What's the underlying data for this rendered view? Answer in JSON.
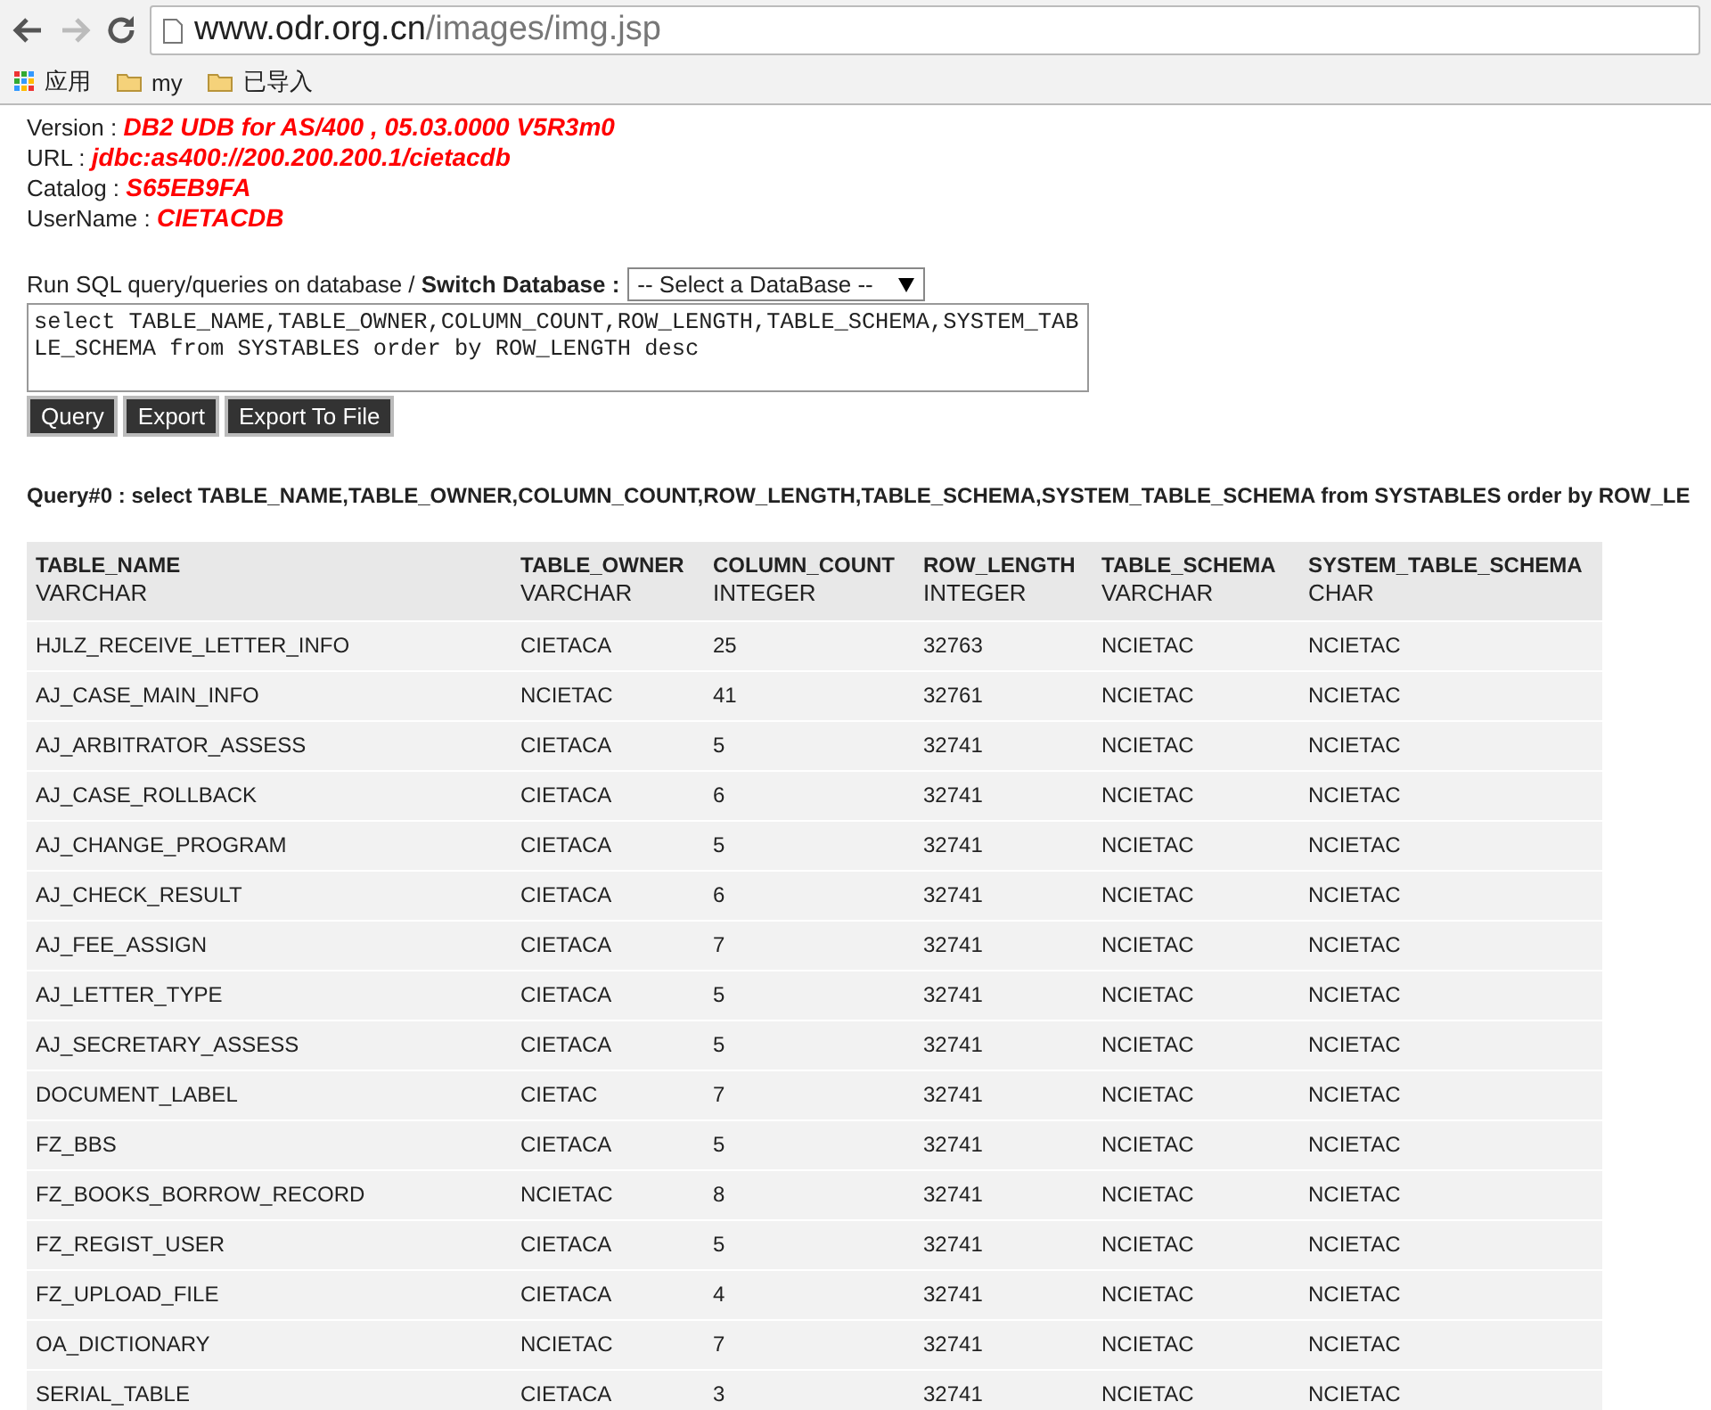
{
  "browser": {
    "url_host": "www.odr.org.cn",
    "url_path": "/images/img.jsp",
    "bookmarks": [
      {
        "kind": "apps",
        "label": "应用"
      },
      {
        "kind": "folder",
        "label": "my"
      },
      {
        "kind": "folder",
        "label": "已导入"
      }
    ]
  },
  "info": [
    {
      "label": "Version :",
      "value": "DB2 UDB for AS/400 , 05.03.0000 V5R3m0"
    },
    {
      "label": "URL :",
      "value": "jdbc:as400://200.200.200.1/cietacdb"
    },
    {
      "label": "Catalog :",
      "value": "S65EB9FA"
    },
    {
      "label": "UserName :",
      "value": "CIETACDB"
    }
  ],
  "run_label": "Run SQL query/queries on database / **Switch Database :**",
  "database_select": "-- Select a DataBase --",
  "sql": "select TABLE_NAME,TABLE_OWNER,COLUMN_COUNT,ROW_LENGTH,TABLE_SCHEMA,SYSTEM_TABLE_SCHEMA from SYSTABLES order by ROW_LENGTH desc",
  "buttons": [
    "Query",
    "Export",
    "Export To File"
  ],
  "query_title": "Query#0 : select TABLE_NAME,TABLE_OWNER,COLUMN_COUNT,ROW_LENGTH,TABLE_SCHEMA,SYSTEM_TABLE_SCHEMA from SYSTABLES order by ROW_LE",
  "table": {
    "columns": [
      {
        "name": "TABLE_NAME",
        "type": "VARCHAR"
      },
      {
        "name": "TABLE_OWNER",
        "type": "VARCHAR"
      },
      {
        "name": "COLUMN_COUNT",
        "type": "INTEGER"
      },
      {
        "name": "ROW_LENGTH",
        "type": "INTEGER"
      },
      {
        "name": "TABLE_SCHEMA",
        "type": "VARCHAR"
      },
      {
        "name": "SYSTEM_TABLE_SCHEMA",
        "type": "CHAR"
      }
    ],
    "rows": [
      [
        "HJLZ_RECEIVE_LETTER_INFO",
        "CIETACA",
        "25",
        "32763",
        "NCIETAC",
        "NCIETAC"
      ],
      [
        "AJ_CASE_MAIN_INFO",
        "NCIETAC",
        "41",
        "32761",
        "NCIETAC",
        "NCIETAC"
      ],
      [
        "AJ_ARBITRATOR_ASSESS",
        "CIETACA",
        "5",
        "32741",
        "NCIETAC",
        "NCIETAC"
      ],
      [
        "AJ_CASE_ROLLBACK",
        "CIETACA",
        "6",
        "32741",
        "NCIETAC",
        "NCIETAC"
      ],
      [
        "AJ_CHANGE_PROGRAM",
        "CIETACA",
        "5",
        "32741",
        "NCIETAC",
        "NCIETAC"
      ],
      [
        "AJ_CHECK_RESULT",
        "CIETACA",
        "6",
        "32741",
        "NCIETAC",
        "NCIETAC"
      ],
      [
        "AJ_FEE_ASSIGN",
        "CIETACA",
        "7",
        "32741",
        "NCIETAC",
        "NCIETAC"
      ],
      [
        "AJ_LETTER_TYPE",
        "CIETACA",
        "5",
        "32741",
        "NCIETAC",
        "NCIETAC"
      ],
      [
        "AJ_SECRETARY_ASSESS",
        "CIETACA",
        "5",
        "32741",
        "NCIETAC",
        "NCIETAC"
      ],
      [
        "DOCUMENT_LABEL",
        "CIETAC",
        "7",
        "32741",
        "NCIETAC",
        "NCIETAC"
      ],
      [
        "FZ_BBS",
        "CIETACA",
        "5",
        "32741",
        "NCIETAC",
        "NCIETAC"
      ],
      [
        "FZ_BOOKS_BORROW_RECORD",
        "NCIETAC",
        "8",
        "32741",
        "NCIETAC",
        "NCIETAC"
      ],
      [
        "FZ_REGIST_USER",
        "CIETACA",
        "5",
        "32741",
        "NCIETAC",
        "NCIETAC"
      ],
      [
        "FZ_UPLOAD_FILE",
        "CIETACA",
        "4",
        "32741",
        "NCIETAC",
        "NCIETAC"
      ],
      [
        "OA_DICTIONARY",
        "NCIETAC",
        "7",
        "32741",
        "NCIETAC",
        "NCIETAC"
      ],
      [
        "SERIAL_TABLE",
        "CIETACA",
        "3",
        "32741",
        "NCIETAC",
        "NCIETAC"
      ]
    ]
  }
}
